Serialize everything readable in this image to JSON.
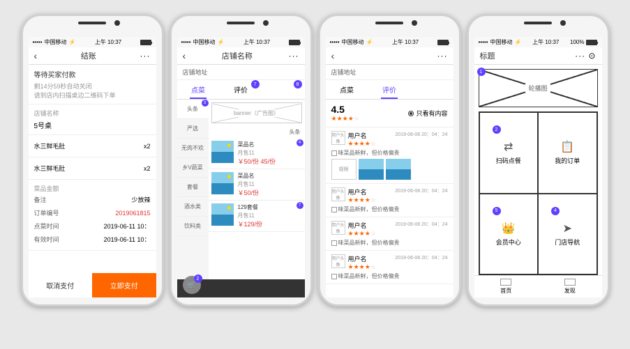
{
  "status": {
    "carrier": "中国移动",
    "time": "上午 10:37",
    "battery_pct": "100%"
  },
  "s1": {
    "title": "结账",
    "wait": "等待买家付款",
    "countdown": "剩14分59秒自动关闭",
    "scan_hint": "请到店内扫描桌边二维码下单",
    "store_label": "店铺名称",
    "store": "5号桌",
    "items": [
      {
        "name": "水三鲜毛肚",
        "qty": "x2"
      },
      {
        "name": "水三鲜毛肚",
        "qty": "x2"
      }
    ],
    "total_label": "菜品金额",
    "note_label": "备注",
    "note_value": "少放辣",
    "order_no_label": "订单编号",
    "order_no": "2019061815",
    "order_time_label": "点菜时间",
    "order_time": "2019-06-11 10：",
    "valid_label": "有效时间",
    "valid": "2019-06-11 10：",
    "btn_cancel": "取消支付",
    "btn_pay": "立即支付"
  },
  "s2": {
    "title": "店铺名称",
    "addr": "店铺地址",
    "tabs": [
      "点菜",
      "评价"
    ],
    "banner": "banner（广告图）",
    "cat_head": "头条",
    "cats": [
      "严选",
      "无肉不欢",
      "乡V蔬菜",
      "套餐",
      "酒水类",
      "饮料类"
    ],
    "dishes": [
      {
        "name": "菜品名",
        "sales": "月售11",
        "price": "￥50/份 45/份",
        "badge": "4"
      },
      {
        "name": "菜品名",
        "sales": "月售11",
        "price": "￥50/份",
        "badge": ""
      },
      {
        "name": "129套餐",
        "sales": "月售11",
        "price": "￥129/份",
        "badge": "7"
      }
    ],
    "cart_count": "2"
  },
  "s3": {
    "addr": "店铺地址",
    "tabs": [
      "点菜",
      "评价"
    ],
    "score": "4.5",
    "radio_label": "只看有内容",
    "reviews": [
      {
        "name": "用户名",
        "date": "2019-06-08 20：04：24",
        "comment": "味菜品新鲜，但价格偏贵",
        "has_imgs": true
      },
      {
        "name": "用户名",
        "date": "2019-06-08 20：04：24",
        "comment": "味菜品新鲜，但价格偏贵",
        "has_imgs": false
      },
      {
        "name": "用户名",
        "date": "2019-06-08 20：04：24",
        "comment": "味菜品新鲜，但价格偏贵",
        "has_imgs": false
      },
      {
        "name": "用户名",
        "date": "2019-06-08 20：04：24",
        "comment": "味菜品新鲜，但价格偏贵",
        "has_imgs": false
      }
    ],
    "avatar_label": "用户头像",
    "video_label": "视频"
  },
  "s4": {
    "title": "标题",
    "carousel": "轮播图",
    "grid": [
      {
        "icon": "⇄",
        "label": "扫码点餐",
        "badge": "2"
      },
      {
        "icon": "📋",
        "label": "我的订单",
        "badge": ""
      },
      {
        "icon": "👑",
        "label": "会员中心",
        "badge": "5"
      },
      {
        "icon": "➤",
        "label": "门店导航",
        "badge": "4"
      }
    ],
    "bottom": [
      "首页",
      "发现"
    ]
  }
}
